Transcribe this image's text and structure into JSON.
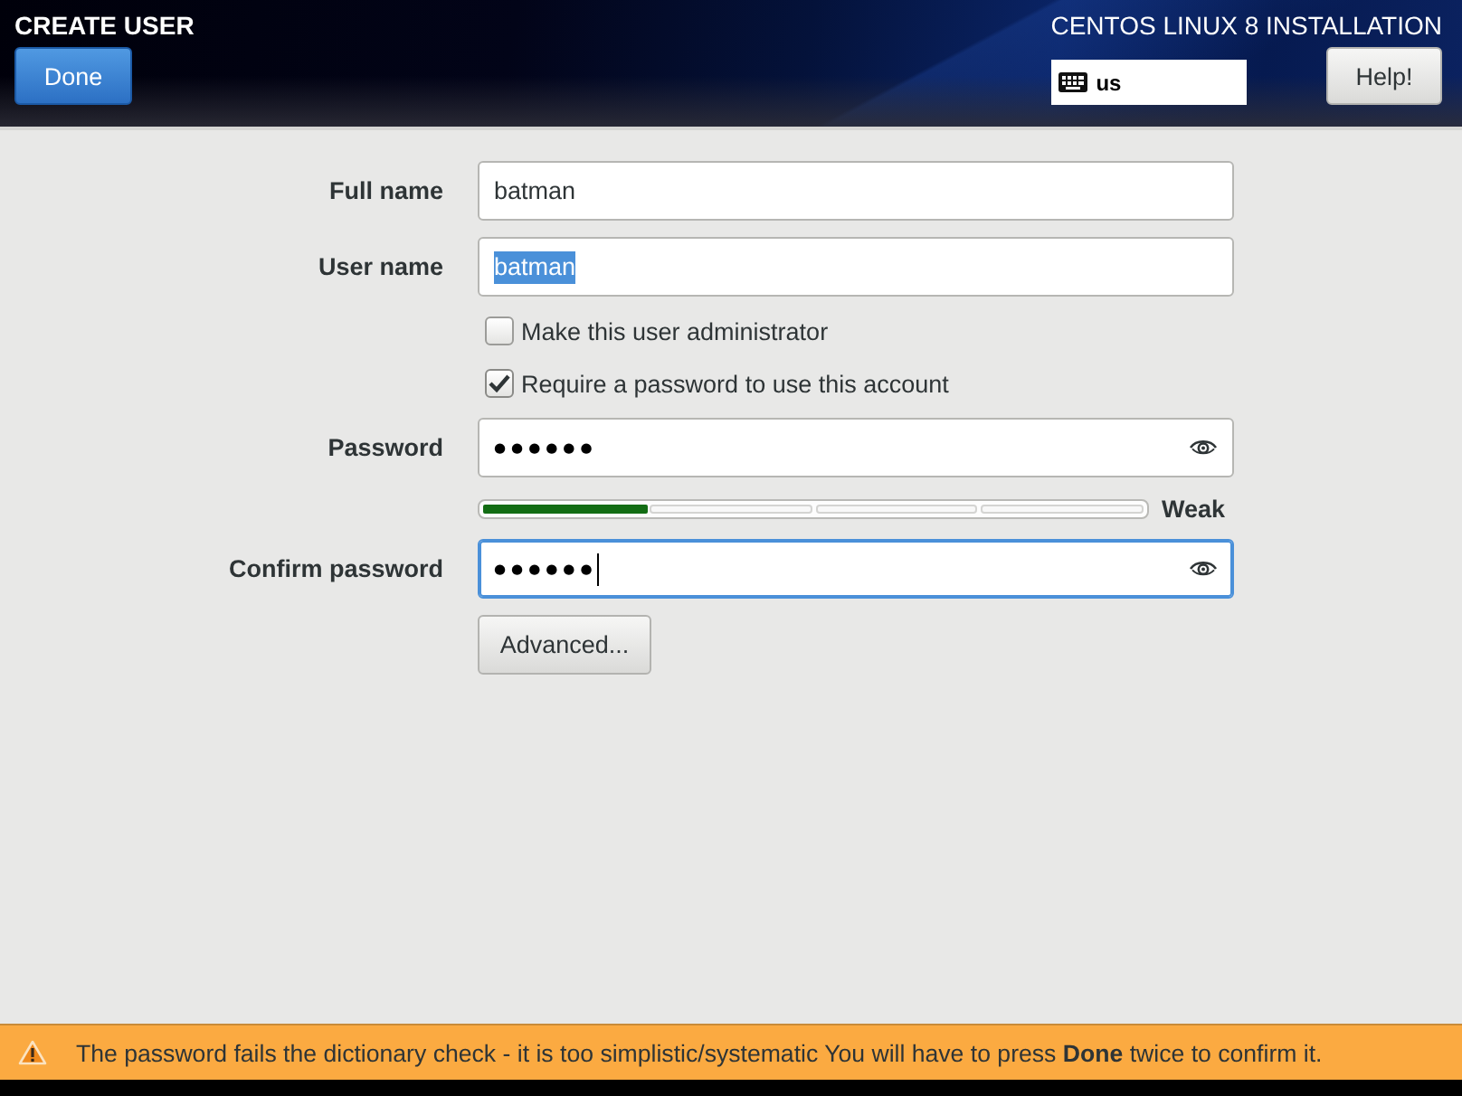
{
  "header": {
    "title": "CREATE USER",
    "done_button": "Done",
    "product": "CENTOS LINUX 8 INSTALLATION",
    "keyboard_layout": "us",
    "help_button": "Help!"
  },
  "rows": [
    {
      "kind": "text_field",
      "label": "Full name",
      "value": "batman",
      "highlighted": false,
      "focused": false
    },
    {
      "kind": "text_field",
      "label": "User name",
      "value": "batman",
      "highlighted": true,
      "focused": false
    },
    {
      "kind": "checkbox",
      "label": "Make this user administrator",
      "checked": false
    },
    {
      "kind": "checkbox",
      "label": "Require a password to use this account",
      "checked": true
    },
    {
      "kind": "password_field",
      "label": "Password",
      "value": "●●●●●●",
      "focused": false
    },
    {
      "kind": "strength_meter",
      "level": 0.25,
      "reading": "Weak"
    },
    {
      "kind": "password_field",
      "label": "Confirm password",
      "value": "●●●●●●",
      "focused": true
    },
    {
      "kind": "button",
      "label": "Advanced..."
    }
  ],
  "warning_bar": {
    "message": "The password fails the dictionary check - it is too simplistic/systematic You will have to press **Done** twice to confirm it."
  }
}
